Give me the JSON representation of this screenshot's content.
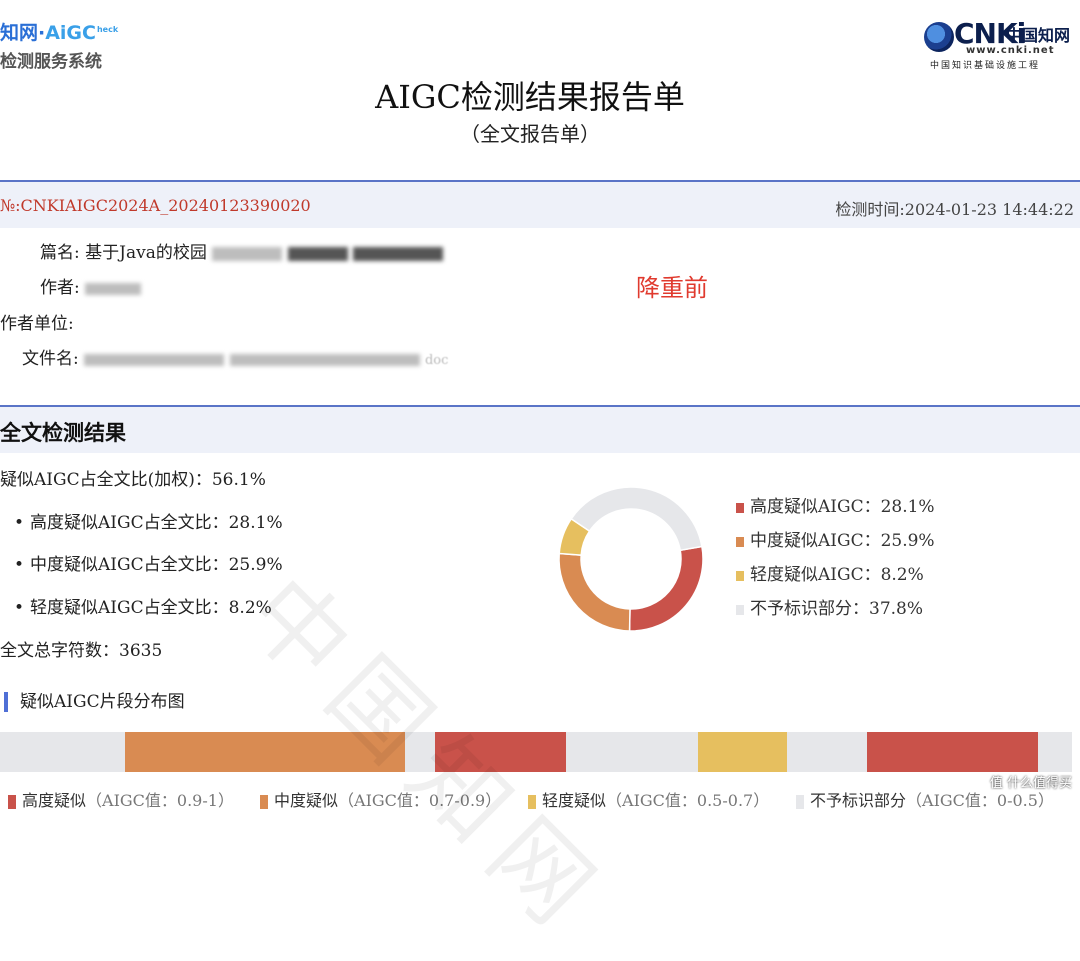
{
  "header": {
    "left_logo_line1_a": "知网·",
    "left_logo_line1_b": "AiGC",
    "left_logo_line1_c": "heck",
    "left_logo_line2": "检测服务系统",
    "right_logo_text": "CNKi",
    "right_logo_cn": "中国知网",
    "right_logo_url": "www.cnki.net",
    "right_logo_sub": "中国知识基础设施工程"
  },
  "title": "AIGC检测结果报告单",
  "subtitle": "（全文报告单）",
  "report": {
    "number": "№:CNKIAIGC2024A_20240123390020",
    "time": "检测时间:2024-01-23 14:44:22"
  },
  "info": {
    "title_label": "篇名:",
    "title_value_visible": "基于Java的校园",
    "author_label": "作者:",
    "unit_label": "作者单位:",
    "file_label": "文件名:",
    "file_tail": "doc",
    "note": "降重前"
  },
  "section": {
    "title": "全文检测结果",
    "weighted": "疑似AIGC占全文比(加权)：56.1%",
    "high": "高度疑似AIGC占全文比：28.1%",
    "mid": "中度疑似AIGC占全文比：25.9%",
    "low": "轻度疑似AIGC占全文比：8.2%",
    "total_chars": "全文总字符数：3635"
  },
  "chart_data": {
    "type": "pie",
    "donut": true,
    "categories": [
      "高度疑似AIGC",
      "中度疑似AIGC",
      "轻度疑似AIGC",
      "不予标识部分"
    ],
    "values": [
      28.1,
      25.9,
      8.2,
      37.8
    ],
    "colors": [
      "#c9524a",
      "#d98b52",
      "#e6bf5f",
      "#e6e7ea"
    ],
    "labels": [
      "高度疑似AIGC：28.1%",
      "中度疑似AIGC：25.9%",
      "轻度疑似AIGC：8.2%",
      "不予标识部分：37.8%"
    ],
    "legend_position": "right"
  },
  "distribution": {
    "title": "疑似AIGC片段分布图",
    "segments": [
      {
        "start": 0.117,
        "end": 0.378,
        "level": "mid"
      },
      {
        "start": 0.406,
        "end": 0.528,
        "level": "high"
      },
      {
        "start": 0.651,
        "end": 0.734,
        "level": "low"
      },
      {
        "start": 0.809,
        "end": 0.968,
        "level": "high"
      }
    ],
    "legend": [
      {
        "label": "高度疑似",
        "range": "（AIGC值：0.9-1）",
        "color": "#c9524a"
      },
      {
        "label": "中度疑似",
        "range": "（AIGC值：0.7-0.9）",
        "color": "#d98b52"
      },
      {
        "label": "轻度疑似",
        "range": "（AIGC值：0.5-0.7）",
        "color": "#e6bf5f"
      },
      {
        "label": "不予标识部分",
        "range": "（AIGC值：0-0.5）",
        "color": "#e6e7ea"
      }
    ]
  },
  "watermark": "中国知网",
  "corner_mark": "值 什么值得买"
}
